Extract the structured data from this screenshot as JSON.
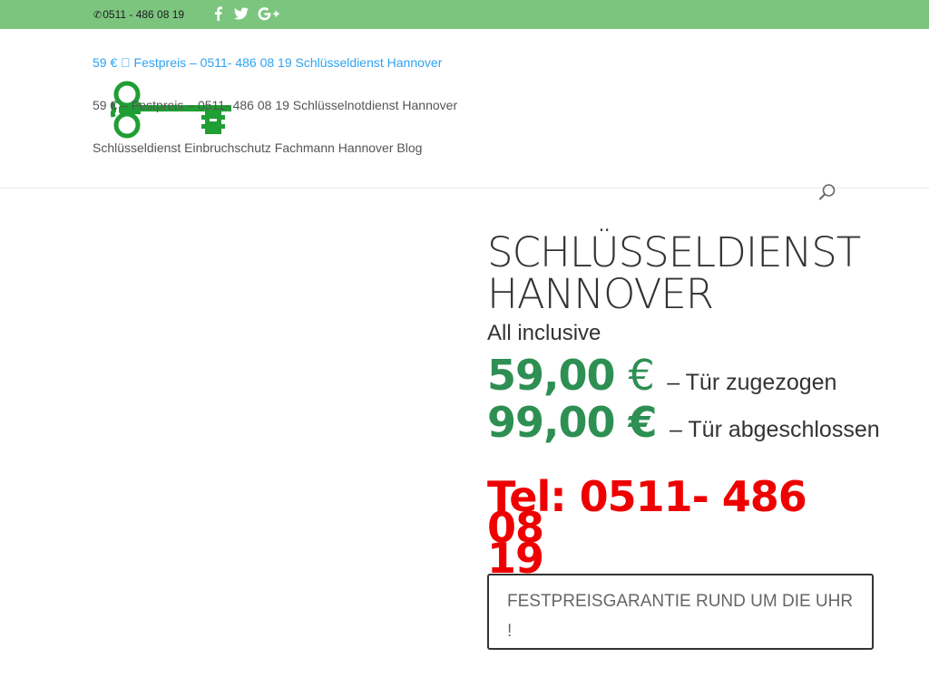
{
  "topbar": {
    "phone": "0511 - 486 08 19",
    "social_icons": [
      "facebook-icon",
      "twitter-icon",
      "google-plus-icon"
    ],
    "bg_color": "#7cc57f"
  },
  "nav": {
    "items": [
      {
        "label": "59 € ⃣ Festpreis – 0511- 486 08 19 Schlüsseldienst Hannover",
        "active": true
      },
      {
        "label": "59 € – Festpreis – 0511- 486 08 19 Schlüsselnotdienst Hannover",
        "active": false
      },
      {
        "label": "Schlüsseldienst Einbruchschutz Fachmann Hannover Blog",
        "active": false
      }
    ]
  },
  "main": {
    "title_line1": "SCHLÜSSELDIENST",
    "title_line2": "HANNOVER",
    "all_inclusive": "All inclusive",
    "prices": [
      {
        "amount": "59,00",
        "currency": "€",
        "desc": "– Tür zugezogen"
      },
      {
        "amount": "99,00",
        "currency": "€",
        "desc": "– Tür abgeschlossen"
      }
    ],
    "tel_line1": "Tel: 0511- 486 08",
    "tel_line2": "19",
    "guarantee_button": "FESTPREISGARANTIE RUND UM DIE UHR !"
  },
  "colors": {
    "accent_green": "#2e8f53",
    "link_blue": "#2ea3f2",
    "phone_red": "#ee0000",
    "logo_green": "#1f9e33"
  }
}
